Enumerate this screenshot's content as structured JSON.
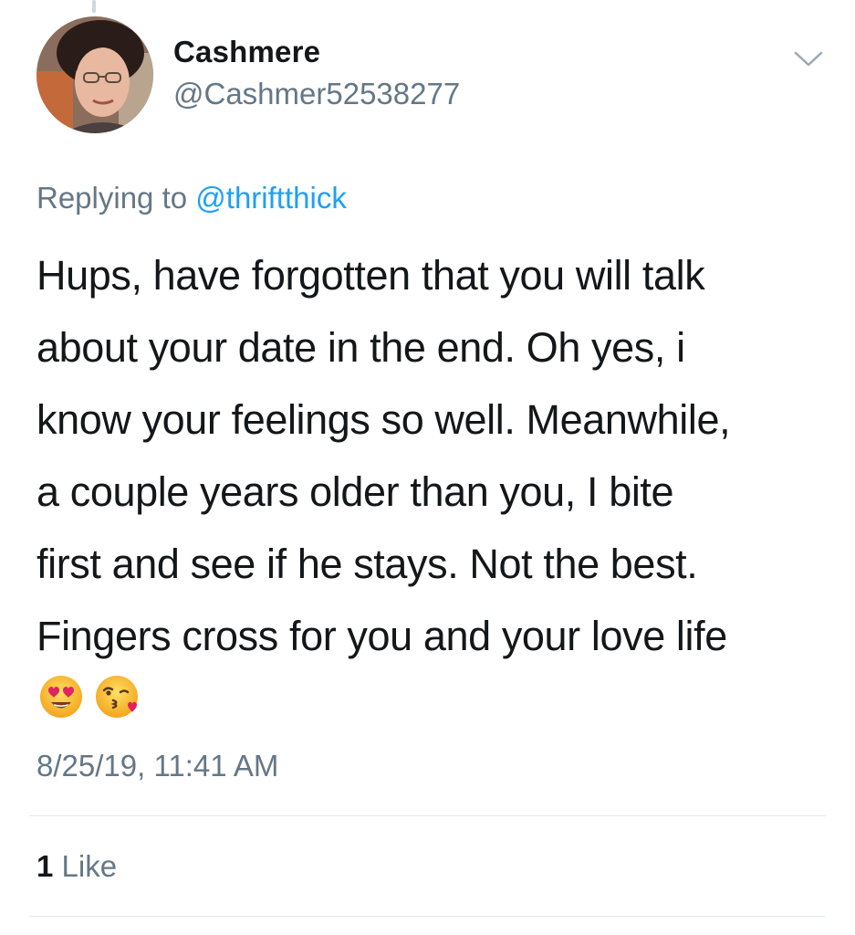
{
  "tweet": {
    "author": {
      "display_name": "Cashmere",
      "handle": "@Cashmer52538277"
    },
    "reply": {
      "prefix": "Replying to",
      "mention": "@thriftthick"
    },
    "text": "Hups, have forgotten that you will talk\nabout your date in the end. Oh yes, i\nknow your feelings so well. Meanwhile,\na couple years older than you, I bite\nfirst and see if he stays. Not the best.\nFingers cross for you and your love life",
    "emojis": [
      "heart-eyes-emoji",
      "kissing-heart-emoji"
    ],
    "timestamp": "8/25/19, 11:41 AM",
    "likes": {
      "count": "1",
      "label": "Like"
    }
  },
  "colors": {
    "text": "#14171a",
    "muted": "#657786",
    "link": "#1da1f2",
    "divider": "#e1e8ed"
  }
}
